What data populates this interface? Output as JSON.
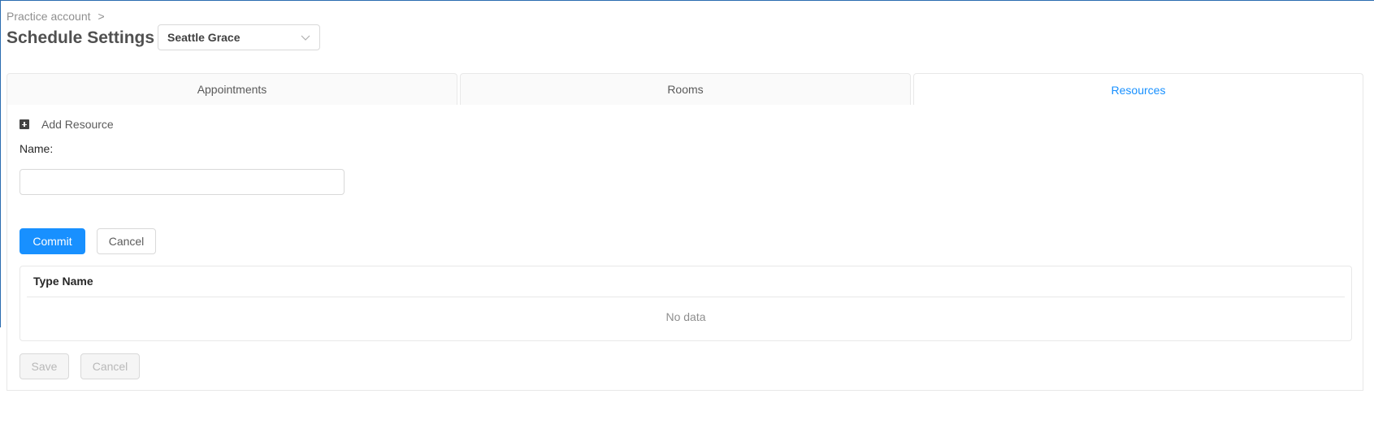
{
  "breadcrumb": {
    "item": "Practice account",
    "separator": ">"
  },
  "page_title": "Schedule Settings",
  "location_select": {
    "value": "Seattle Grace"
  },
  "tabs": [
    {
      "label": "Appointments",
      "active": false
    },
    {
      "label": "Rooms",
      "active": false
    },
    {
      "label": "Resources",
      "active": true
    }
  ],
  "form": {
    "add_label": "Add Resource",
    "name_label": "Name:",
    "name_value": "",
    "commit_label": "Commit",
    "cancel_label": "Cancel"
  },
  "table": {
    "columns": [
      "Type Name"
    ],
    "rows": [],
    "empty_text": "No data"
  },
  "footer": {
    "save_label": "Save",
    "cancel_label": "Cancel"
  },
  "colors": {
    "accent": "#1890ff",
    "border": "#d9d9d9",
    "window_edge": "#2b6cb0"
  }
}
